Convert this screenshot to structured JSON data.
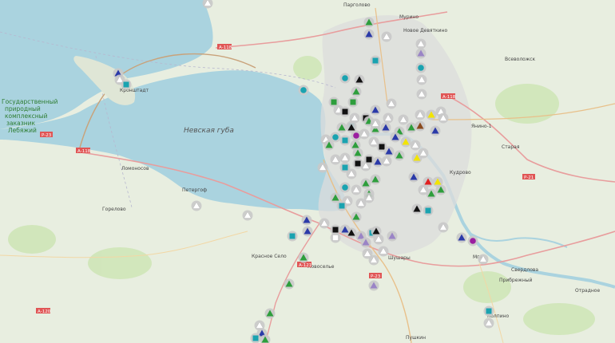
{
  "map": {
    "gulf_label": "Невская губа",
    "reserve_label_lines": [
      "Государственный",
      "природный",
      "комплексный",
      "заказник",
      "Лебяжий"
    ],
    "places": [
      {
        "id": "kronshtadt",
        "label": "Кронштадт"
      },
      {
        "id": "lomonosov",
        "label": "Ломоносов"
      },
      {
        "id": "petergof",
        "label": "Петергоф"
      },
      {
        "id": "kolpino",
        "label": "Колпино"
      },
      {
        "id": "pushkin",
        "label": "Пушкин"
      },
      {
        "id": "shushary",
        "label": "Шушары"
      },
      {
        "id": "krasnoe-selo",
        "label": "Красное Село"
      },
      {
        "id": "kudrovo",
        "label": "Кудрово"
      },
      {
        "id": "murino",
        "label": "Мурино"
      },
      {
        "id": "pargolovo",
        "label": "Парголово"
      },
      {
        "id": "novoe-devyatkino",
        "label": "Новое Девяткино"
      },
      {
        "id": "vsevolozhsk",
        "label": "Всеволожск"
      },
      {
        "id": "yanino",
        "label": "Янино-1"
      },
      {
        "id": "starai",
        "label": "Старая"
      },
      {
        "id": "mga",
        "label": "Мга"
      },
      {
        "id": "sverdlova",
        "label": "Свердлова"
      },
      {
        "id": "otradnoe",
        "label": "Отрадное"
      },
      {
        "id": "pribrezhny",
        "label": "Прибрежный"
      },
      {
        "id": "novoselye",
        "label": "Новоселье"
      },
      {
        "id": "gorelovo",
        "label": "Горелово"
      }
    ],
    "road_labels": [
      "А-118",
      "А-118",
      "А-118",
      "А-120",
      "А-121",
      "Р-23",
      "Р-21",
      "Р-23"
    ],
    "marker_colors": {
      "green": "#2e9e3c",
      "blue": "#2b3aa8",
      "white": "#ffffff",
      "gray": "#9aa0a6",
      "purple": "#9a84c6",
      "teal": "#1aa3b0",
      "black": "#111111",
      "yellow": "#f2e400",
      "red": "#e02020",
      "brown": "#8a4a1c",
      "magenta": "#9b1fa0"
    },
    "marker_types": [
      "green-triangle",
      "blue-triangle",
      "white-triangle",
      "gray-triangle",
      "purple-triangle",
      "teal-square",
      "green-square",
      "black-square",
      "white-square",
      "teal-circle",
      "magenta-circle",
      "black-triangle",
      "yellow-triangle",
      "red-triangle",
      "brown-triangle"
    ]
  }
}
